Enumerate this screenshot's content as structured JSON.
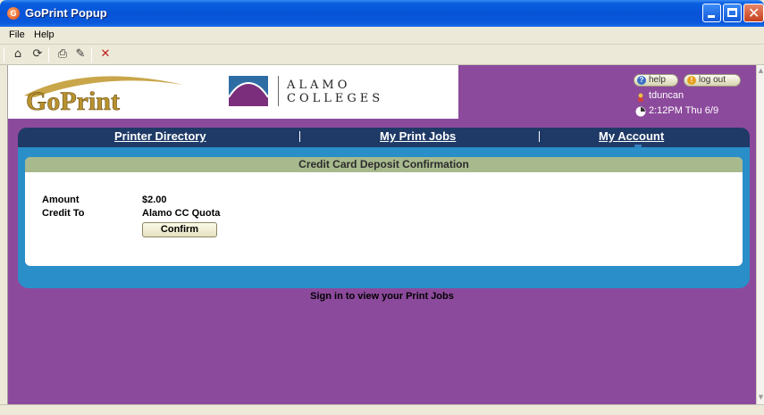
{
  "window": {
    "title": "GoPrint Popup"
  },
  "menu": {
    "file": "File",
    "help": "Help"
  },
  "toolbar": {
    "icons": [
      "home-icon",
      "refresh-icon",
      "print-icon",
      "edit-icon",
      "stop-icon"
    ]
  },
  "header": {
    "goprint_logo_text": "GoPrint",
    "alamo_line1": "ALAMO",
    "alamo_line2": "COLLEGES",
    "help_label": "help",
    "logout_label": "log out",
    "username": "tduncan",
    "datetime": "2:12PM Thu 6/9"
  },
  "nav": {
    "printer_directory": "Printer Directory",
    "my_print_jobs": "My Print Jobs",
    "my_account": "My Account",
    "separator": "|"
  },
  "panel": {
    "title": "Credit Card Deposit Confirmation",
    "amount_label": "Amount",
    "amount_value": "$2.00",
    "credit_to_label": "Credit To",
    "credit_to_value": "Alamo CC Quota",
    "confirm_label": "Confirm"
  },
  "message": "Sign in to view your Print Jobs",
  "colors": {
    "page_background": "#8c4a9c",
    "nav_bar": "#1f3a66",
    "panel_border": "#2a8ec9",
    "panel_title": "#a7b98d"
  }
}
